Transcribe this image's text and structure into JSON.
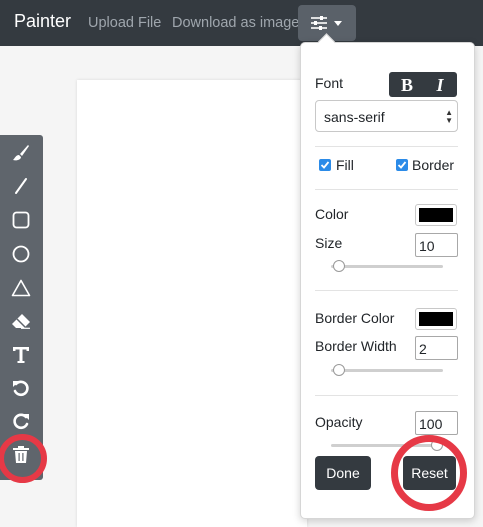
{
  "navbar": {
    "brand": "Painter",
    "links": [
      "Upload File",
      "Download as image"
    ],
    "settings_icon": "sliders-icon"
  },
  "toolbar": {
    "tools": [
      "brush-icon",
      "line-icon",
      "rectangle-icon",
      "circle-icon",
      "triangle-icon",
      "eraser-icon",
      "text-icon",
      "undo-icon",
      "redo-icon",
      "trash-icon"
    ]
  },
  "settings": {
    "font_label": "Font",
    "bold_label": "B",
    "italic_label": "I",
    "font_family": "sans-serif",
    "fill_label": "Fill",
    "fill_checked": true,
    "border_label": "Border",
    "border_checked": true,
    "color_label": "Color",
    "color_value": "#000000",
    "size_label": "Size",
    "size_value": "10",
    "border_color_label": "Border Color",
    "border_color_value": "#000000",
    "border_width_label": "Border Width",
    "border_width_value": "2",
    "opacity_label": "Opacity",
    "opacity_value": "100",
    "done_label": "Done",
    "reset_label": "Reset"
  },
  "colors": {
    "navbar": "#343a40",
    "accent": "#2b8be8",
    "highlight": "#e63946"
  }
}
